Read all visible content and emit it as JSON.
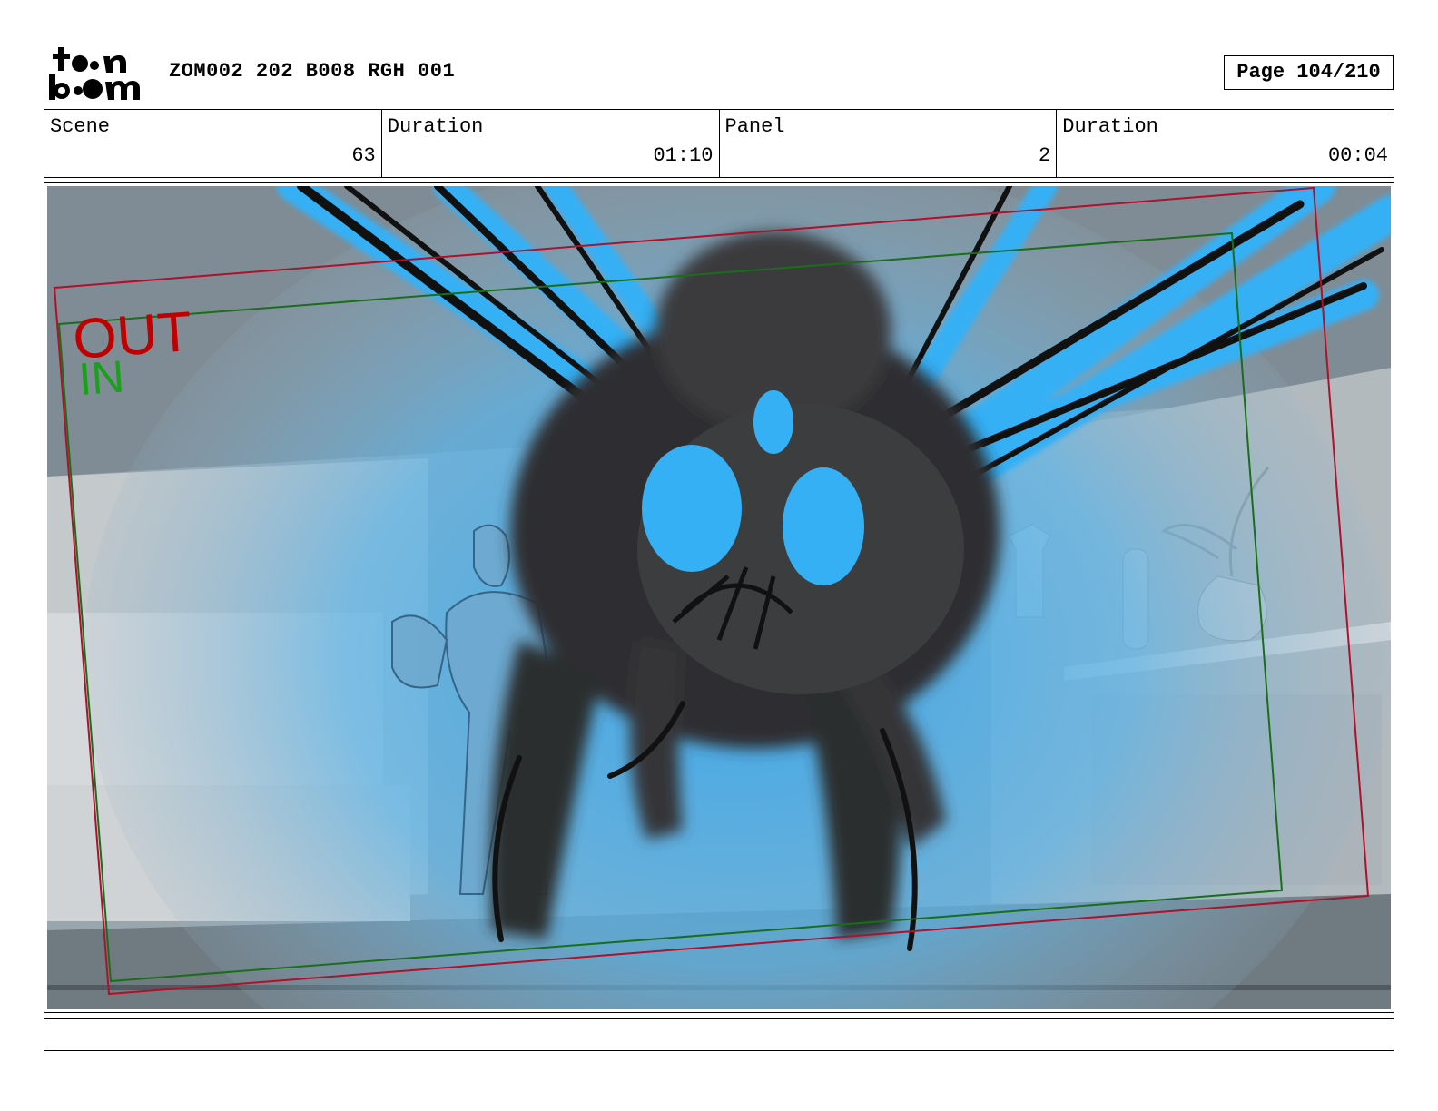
{
  "header": {
    "logo_text": "toonboom",
    "production_title": "ZOM002 202 B008 RGH 001",
    "page_label": "Page 104/210"
  },
  "info": {
    "scene_label": "Scene",
    "scene_value": "63",
    "scene_duration_label": "Duration",
    "scene_duration_value": "01:10",
    "panel_label": "Panel",
    "panel_value": "2",
    "panel_duration_label": "Duration",
    "panel_duration_value": "00:04"
  },
  "camera": {
    "out_label": "OUT",
    "in_label": "IN",
    "out_color": "#c00000",
    "in_color": "#1aa01a"
  },
  "colors": {
    "accent_blue": "#35b0f5",
    "ink": "#1a1a1a"
  },
  "notes": {
    "text": ""
  }
}
